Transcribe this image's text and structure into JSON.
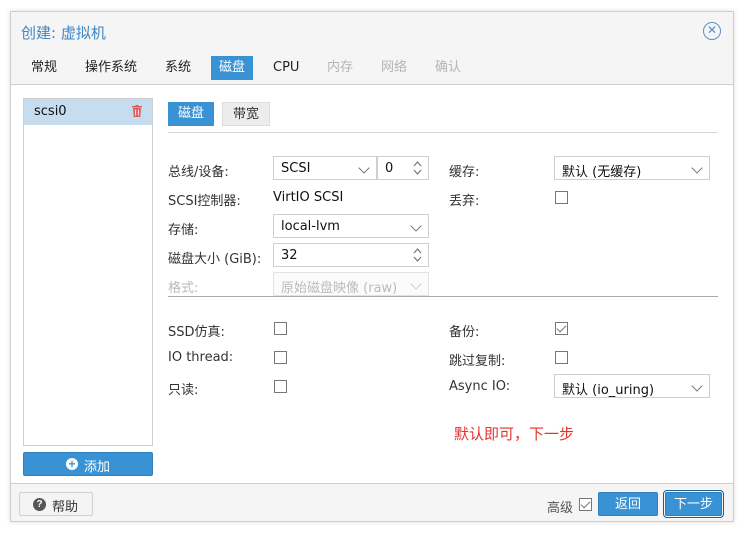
{
  "window": {
    "title": "创建: 虚拟机"
  },
  "tabs": [
    {
      "label": "常规",
      "state": "normal"
    },
    {
      "label": "操作系统",
      "state": "normal"
    },
    {
      "label": "系统",
      "state": "normal"
    },
    {
      "label": "磁盘",
      "state": "active"
    },
    {
      "label": "CPU",
      "state": "normal"
    },
    {
      "label": "内存",
      "state": "disabled"
    },
    {
      "label": "网络",
      "state": "disabled"
    },
    {
      "label": "确认",
      "state": "disabled"
    }
  ],
  "disk_list": {
    "items": [
      {
        "label": "scsi0",
        "selected": true
      }
    ],
    "add_label": "添加"
  },
  "subtabs": [
    {
      "label": "磁盘",
      "active": true
    },
    {
      "label": "带宽",
      "active": false
    }
  ],
  "form": {
    "bus_label": "总线/设备:",
    "bus_value": "SCSI",
    "device_value": "0",
    "controller_label": "SCSI控制器:",
    "controller_value": "VirtIO SCSI",
    "storage_label": "存储:",
    "storage_value": "local-lvm",
    "size_label": "磁盘大小 (GiB):",
    "size_value": "32",
    "format_label": "格式:",
    "format_value": "原始磁盘映像 (raw)",
    "cache_label": "缓存:",
    "cache_value": "默认 (无缓存)",
    "discard_label": "丢弃:",
    "discard_checked": false,
    "ssd_label": "SSD仿真:",
    "ssd_checked": false,
    "iothread_label": "IO thread:",
    "iothread_checked": false,
    "readonly_label": "只读:",
    "readonly_checked": false,
    "backup_label": "备份:",
    "backup_checked": true,
    "skip_repl_label": "跳过复制:",
    "skip_repl_checked": false,
    "asyncio_label": "Async IO:",
    "asyncio_value": "默认 (io_uring)"
  },
  "annotation": "默认即可，下一步",
  "footer": {
    "help_label": "帮助",
    "advanced_label": "高级",
    "advanced_checked": true,
    "back_label": "返回",
    "next_label": "下一步"
  },
  "colors": {
    "accent": "#3892d4",
    "title": "#3f85c5",
    "annotation": "#e5322d"
  }
}
